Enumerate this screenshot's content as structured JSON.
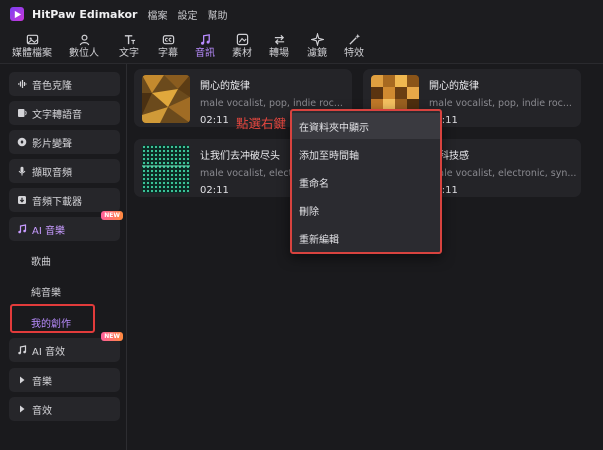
{
  "app": {
    "name": "HitPaw Edimakor",
    "menu": [
      "檔案",
      "設定",
      "幫助"
    ]
  },
  "toolbar": {
    "tools": [
      {
        "label": "媒體檔案",
        "icon": "image-icon"
      },
      {
        "label": "數位人",
        "icon": "avatar-person-icon"
      },
      {
        "label": "文字",
        "icon": "text-icon"
      },
      {
        "label": "字幕",
        "icon": "caption-icon"
      },
      {
        "label": "音訊",
        "icon": "music-note-icon",
        "active": true
      },
      {
        "label": "素材",
        "icon": "material-icon"
      },
      {
        "label": "轉場",
        "icon": "transition-icon"
      },
      {
        "label": "濾鏡",
        "icon": "filter-sparkle-icon"
      },
      {
        "label": "特效",
        "icon": "effects-wand-icon"
      }
    ]
  },
  "sidebar": {
    "buttons": [
      {
        "label": "音色克隆",
        "icon": "voice-clone-icon"
      },
      {
        "label": "文字轉語音",
        "icon": "text-to-speech-icon"
      },
      {
        "label": "影片變聲",
        "icon": "voice-changer-icon"
      },
      {
        "label": "擷取音頻",
        "icon": "microphone-icon"
      },
      {
        "label": "音頻下載器",
        "icon": "download-icon"
      },
      {
        "label": "AI 音樂",
        "icon": "ai-music-icon",
        "badge": "NEW",
        "active": true
      },
      {
        "label": "AI 音效",
        "icon": "ai-sound-effect-icon",
        "badge": "NEW"
      },
      {
        "label": "音樂",
        "icon": "caret-right-icon"
      },
      {
        "label": "音效",
        "icon": "caret-right-icon"
      }
    ],
    "subitems": [
      {
        "label": "歌曲"
      },
      {
        "label": "純音樂"
      },
      {
        "label": "我的創作",
        "selected": true
      }
    ]
  },
  "cards": [
    {
      "title": "開心的旋律",
      "tags": "male vocalist, pop, indie roc...",
      "duration": "02:11"
    },
    {
      "title": "開心的旋律",
      "tags": "male vocalist, pop, indie roc...",
      "duration": "02:11"
    },
    {
      "title": "让我们去冲破尽头",
      "tags": "male vocalist, electro",
      "duration": "02:11"
    },
    {
      "title": "的科技感",
      "tags": "male vocalist, electronic, syn...",
      "duration": "02:11"
    }
  ],
  "annotation": "點選右鍵",
  "context_menu": {
    "items": [
      "在資料夾中顯示",
      "添加至時間軸",
      "重命名",
      "刪除",
      "重新編輯"
    ]
  },
  "colors": {
    "accent": "#b98cff",
    "annotation_red": "#e23b3b",
    "background": "#1a1a1d",
    "card": "#242428"
  }
}
